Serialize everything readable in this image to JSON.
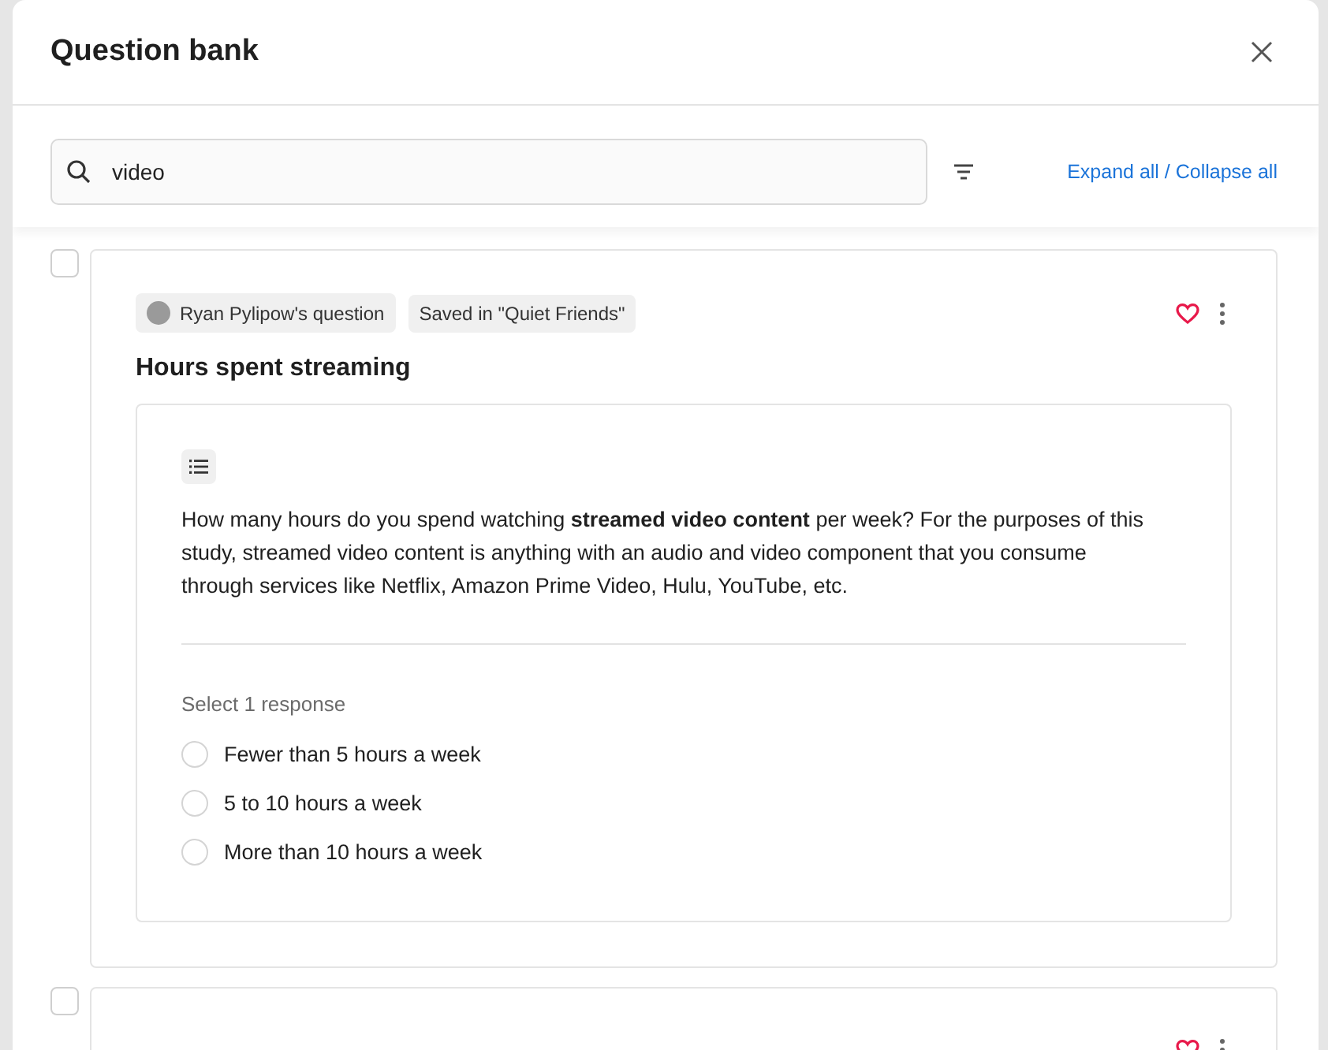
{
  "dialog": {
    "title": "Question bank"
  },
  "search": {
    "value": "video"
  },
  "expand_collapse_link": "Expand all / Collapse all",
  "questions": [
    {
      "selected": false,
      "author_tag": "Ryan Pylipow's question",
      "saved_tag": "Saved in \"Quiet Friends\"",
      "title": "Hours spent streaming",
      "prompt": "How many hours do you spend watching **streamed video content** per week? For the purposes of this study, streamed video content is anything with an audio and video component that you consume through services like Netflix, Amazon Prime Video, Hulu, YouTube, etc.",
      "response_hint": "Select 1 response",
      "options": [
        {
          "label": "Fewer than 5 hours a week",
          "selected": false
        },
        {
          "label": "5 to 10 hours a week",
          "selected": false
        },
        {
          "label": "More than 10 hours a week",
          "selected": false
        }
      ]
    },
    {
      "selected": false
    }
  ]
}
